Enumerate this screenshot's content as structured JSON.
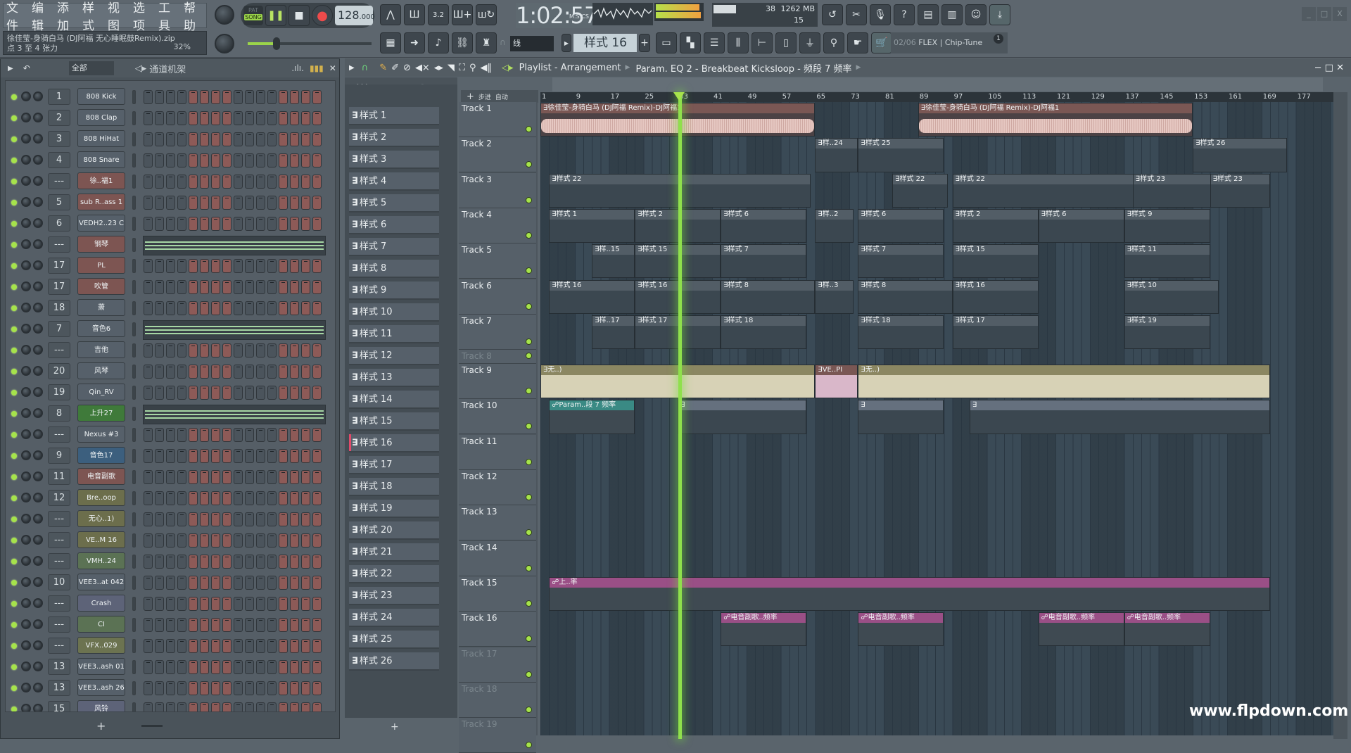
{
  "menu": [
    "文件",
    "编辑",
    "添加",
    "样式",
    "视图",
    "选项",
    "工具",
    "帮助"
  ],
  "hint": {
    "line1": "徐佳莹-身骑白马 (DJ阿福 无心睡眠鼓Remix).zip",
    "line2": "点 3 至 4 张力",
    "pct": "32%"
  },
  "transport": {
    "pat_label": "PAT",
    "song_label": "SONG",
    "mode": "SONG",
    "tempo": "128",
    "tempo_decimal": ".000",
    "time": "1:02:57",
    "time_unit": "M:S:CS"
  },
  "cpu": {
    "cpu_value": "38",
    "memory": "1262 MB",
    "polyphony": "15"
  },
  "snap": {
    "label": "线"
  },
  "pattern_selector": {
    "value": "样式 16"
  },
  "news": {
    "counter": "02/06",
    "text": "FLEX | Chip-Tune",
    "badge": "1"
  },
  "window_controls": [
    "_",
    "□",
    "X"
  ],
  "rack": {
    "filter": "全部",
    "title": "通道机架",
    "channels": [
      {
        "num": "1",
        "name": "808 Kick",
        "color": "#56606a",
        "type": "steps"
      },
      {
        "num": "2",
        "name": "808 Clap",
        "color": "#56606a",
        "type": "steps"
      },
      {
        "num": "3",
        "name": "808 HiHat",
        "color": "#56606a",
        "type": "steps"
      },
      {
        "num": "4",
        "name": "808 Snare",
        "color": "#56606a",
        "type": "steps"
      },
      {
        "num": "---",
        "name": "徐..福1",
        "color": "#7d5552",
        "type": "steps"
      },
      {
        "num": "5",
        "name": "sub R..ass 1",
        "color": "#7d5552",
        "type": "steps"
      },
      {
        "num": "6",
        "name": "VEDH2..23 C",
        "color": "#56606a",
        "type": "steps"
      },
      {
        "num": "---",
        "name": "钢琴",
        "color": "#7d5552",
        "type": "piano"
      },
      {
        "num": "17",
        "name": "PL",
        "color": "#7d5552",
        "type": "steps"
      },
      {
        "num": "17",
        "name": "吹管",
        "color": "#7d5552",
        "type": "steps"
      },
      {
        "num": "18",
        "name": "萧",
        "color": "#56606a",
        "type": "steps"
      },
      {
        "num": "7",
        "name": "音色6",
        "color": "#56606a",
        "type": "piano"
      },
      {
        "num": "---",
        "name": "吉他",
        "color": "#56606a",
        "type": "steps"
      },
      {
        "num": "20",
        "name": "风琴",
        "color": "#56606a",
        "type": "steps"
      },
      {
        "num": "19",
        "name": "Qin_RV",
        "color": "#56606a",
        "type": "steps"
      },
      {
        "num": "8",
        "name": "上升27",
        "color": "#3f7a3a",
        "type": "piano"
      },
      {
        "num": "---",
        "name": "Nexus #3",
        "color": "#56606a",
        "type": "steps"
      },
      {
        "num": "9",
        "name": "音色17",
        "color": "#3c5f7e",
        "type": "steps"
      },
      {
        "num": "11",
        "name": "电音副歌",
        "color": "#7d5552",
        "type": "steps"
      },
      {
        "num": "12",
        "name": "Bre..oop",
        "color": "#6c6e4c",
        "type": "steps"
      },
      {
        "num": "---",
        "name": "无心..1)",
        "color": "#6c6e4c",
        "type": "steps"
      },
      {
        "num": "---",
        "name": "VE..M 16",
        "color": "#6c6e4c",
        "type": "steps"
      },
      {
        "num": "---",
        "name": "VMH..24",
        "color": "#5b7254",
        "type": "steps"
      },
      {
        "num": "10",
        "name": "VEE3..at 042",
        "color": "#56606a",
        "type": "steps"
      },
      {
        "num": "---",
        "name": "Crash",
        "color": "#5d6378",
        "type": "steps"
      },
      {
        "num": "---",
        "name": "CI",
        "color": "#5b7254",
        "type": "steps"
      },
      {
        "num": "---",
        "name": "VFX..029",
        "color": "#6c7350",
        "type": "steps"
      },
      {
        "num": "13",
        "name": "VEE3..ash 01",
        "color": "#56606a",
        "type": "steps"
      },
      {
        "num": "13",
        "name": "VEE3..ash 26",
        "color": "#56606a",
        "type": "steps"
      },
      {
        "num": "15",
        "name": "风铃",
        "color": "#5d6378",
        "type": "steps"
      }
    ],
    "step_pattern": [
      0,
      0,
      0,
      0,
      1,
      1,
      1,
      1,
      0,
      0,
      0,
      0,
      1,
      1,
      1,
      1
    ]
  },
  "patterns": [
    "样式 1",
    "样式 2",
    "样式 3",
    "样式 4",
    "样式 5",
    "样式 6",
    "样式 7",
    "样式 8",
    "样式 9",
    "样式 10",
    "样式 11",
    "样式 12",
    "样式 13",
    "样式 14",
    "样式 15",
    "样式 16",
    "样式 17",
    "样式 18",
    "样式 19",
    "样式 20",
    "样式 21",
    "样式 22",
    "样式 23",
    "样式 24",
    "样式 25",
    "样式 26"
  ],
  "selected_pattern": "样式 16",
  "playlist": {
    "title": "Playlist - Arrangement",
    "breadcrumb": "Param. EQ 2 - Breakbeat Kicksloop - 频段 7 频率",
    "step_label": "步进",
    "auto_label": "自动",
    "ruler": [
      "1",
      "9",
      "17",
      "25",
      "33",
      "41",
      "49",
      "57",
      "65",
      "73",
      "81",
      "89",
      "97",
      "105",
      "113",
      "121",
      "129",
      "137",
      "145",
      "153",
      "161",
      "169",
      "177"
    ],
    "tracks": [
      "Track 1",
      "Track 2",
      "Track 3",
      "Track 4",
      "Track 5",
      "Track 6",
      "Track 7",
      "Track 8",
      "Track 9",
      "Track 10",
      "Track 11",
      "Track 12",
      "Track 13",
      "Track 14",
      "Track 15",
      "Track 16",
      "Track 17",
      "Track 18",
      "Track 19"
    ],
    "clips": [
      {
        "track": 0,
        "start": 1,
        "len": 64,
        "label": "徐佳莹-身骑白马 (DJ阿福 Remix)-DJ阿福1",
        "kind": "audio"
      },
      {
        "track": 0,
        "start": 89,
        "len": 64,
        "label": "徐佳莹-身骑白马 (DJ阿福 Remix)-DJ阿福1",
        "kind": "audio"
      },
      {
        "track": 1,
        "start": 65,
        "len": 10,
        "label": "样..24",
        "kind": "pat"
      },
      {
        "track": 1,
        "start": 75,
        "len": 20,
        "label": "样式 25",
        "kind": "pat"
      },
      {
        "track": 1,
        "start": 153,
        "len": 22,
        "label": "样式 26",
        "kind": "pat"
      },
      {
        "track": 2,
        "start": 3,
        "len": 61,
        "label": "样式 22",
        "kind": "pat"
      },
      {
        "track": 2,
        "start": 83,
        "len": 13,
        "label": "样式 22",
        "kind": "pat"
      },
      {
        "track": 2,
        "start": 97,
        "len": 56,
        "label": "样式 22",
        "kind": "pat"
      },
      {
        "track": 2,
        "start": 139,
        "len": 22,
        "label": "样式 23",
        "kind": "pat"
      },
      {
        "track": 2,
        "start": 157,
        "len": 14,
        "label": "样式 23",
        "kind": "pat"
      },
      {
        "track": 3,
        "start": 3,
        "len": 20,
        "label": "样式 1",
        "kind": "pat"
      },
      {
        "track": 3,
        "start": 23,
        "len": 20,
        "label": "样式 2",
        "kind": "pat"
      },
      {
        "track": 3,
        "start": 43,
        "len": 20,
        "label": "样式 6",
        "kind": "pat"
      },
      {
        "track": 3,
        "start": 65,
        "len": 9,
        "label": "样..2",
        "kind": "pat"
      },
      {
        "track": 3,
        "start": 75,
        "len": 20,
        "label": "样式 6",
        "kind": "pat"
      },
      {
        "track": 3,
        "start": 97,
        "len": 20,
        "label": "样式 2",
        "kind": "pat"
      },
      {
        "track": 3,
        "start": 117,
        "len": 20,
        "label": "样式 6",
        "kind": "pat"
      },
      {
        "track": 3,
        "start": 137,
        "len": 20,
        "label": "样式 9",
        "kind": "pat"
      },
      {
        "track": 4,
        "start": 13,
        "len": 10,
        "label": "样..15",
        "kind": "pat"
      },
      {
        "track": 4,
        "start": 23,
        "len": 20,
        "label": "样式 15",
        "kind": "pat"
      },
      {
        "track": 4,
        "start": 43,
        "len": 20,
        "label": "样式 7",
        "kind": "pat"
      },
      {
        "track": 4,
        "start": 75,
        "len": 20,
        "label": "样式 7",
        "kind": "pat"
      },
      {
        "track": 4,
        "start": 97,
        "len": 20,
        "label": "样式 15",
        "kind": "pat"
      },
      {
        "track": 4,
        "start": 137,
        "len": 20,
        "label": "样式 11",
        "kind": "pat"
      },
      {
        "track": 5,
        "start": 3,
        "len": 20,
        "label": "样式 16",
        "kind": "pat"
      },
      {
        "track": 5,
        "start": 23,
        "len": 20,
        "label": "样式 16",
        "kind": "pat"
      },
      {
        "track": 5,
        "start": 43,
        "len": 22,
        "label": "样式 8",
        "kind": "pat"
      },
      {
        "track": 5,
        "start": 65,
        "len": 9,
        "label": "样..3",
        "kind": "pat"
      },
      {
        "track": 5,
        "start": 75,
        "len": 22,
        "label": "样式 8",
        "kind": "pat"
      },
      {
        "track": 5,
        "start": 97,
        "len": 20,
        "label": "样式 16",
        "kind": "pat"
      },
      {
        "track": 5,
        "start": 137,
        "len": 22,
        "label": "样式 10",
        "kind": "pat"
      },
      {
        "track": 6,
        "start": 13,
        "len": 10,
        "label": "样..17",
        "kind": "pat"
      },
      {
        "track": 6,
        "start": 23,
        "len": 20,
        "label": "样式 17",
        "kind": "pat"
      },
      {
        "track": 6,
        "start": 43,
        "len": 20,
        "label": "样式 18",
        "kind": "pat"
      },
      {
        "track": 6,
        "start": 75,
        "len": 20,
        "label": "样式 18",
        "kind": "pat"
      },
      {
        "track": 6,
        "start": 97,
        "len": 20,
        "label": "样式 17",
        "kind": "pat"
      },
      {
        "track": 6,
        "start": 137,
        "len": 20,
        "label": "样式 19",
        "kind": "pat"
      },
      {
        "track": 8,
        "start": 1,
        "len": 64,
        "label": "无..)",
        "kind": "beige"
      },
      {
        "track": 8,
        "start": 65,
        "len": 10,
        "label": "VE..PI",
        "kind": "pinkaudio"
      },
      {
        "track": 8,
        "start": 75,
        "len": 96,
        "label": "无..)",
        "kind": "beige"
      },
      {
        "track": 9,
        "start": 3,
        "len": 20,
        "label": "Param..段 7 频率",
        "kind": "autog"
      },
      {
        "track": 9,
        "start": 33,
        "len": 30,
        "label": "",
        "kind": "slate"
      },
      {
        "track": 9,
        "start": 75,
        "len": 20,
        "label": "",
        "kind": "slate"
      },
      {
        "track": 9,
        "start": 101,
        "len": 70,
        "label": "",
        "kind": "slate"
      },
      {
        "track": 14,
        "start": 3,
        "len": 168,
        "label": "上..率",
        "kind": "auto"
      },
      {
        "track": 15,
        "start": 43,
        "len": 20,
        "label": "电音副歌..频率",
        "kind": "auto"
      },
      {
        "track": 15,
        "start": 75,
        "len": 20,
        "label": "电音副歌..频率",
        "kind": "auto"
      },
      {
        "track": 15,
        "start": 117,
        "len": 20,
        "label": "电音副歌..频率",
        "kind": "auto"
      },
      {
        "track": 15,
        "start": 137,
        "len": 20,
        "label": "电音副歌..频率",
        "kind": "auto"
      }
    ]
  },
  "watermark": "www.flpdown.com"
}
